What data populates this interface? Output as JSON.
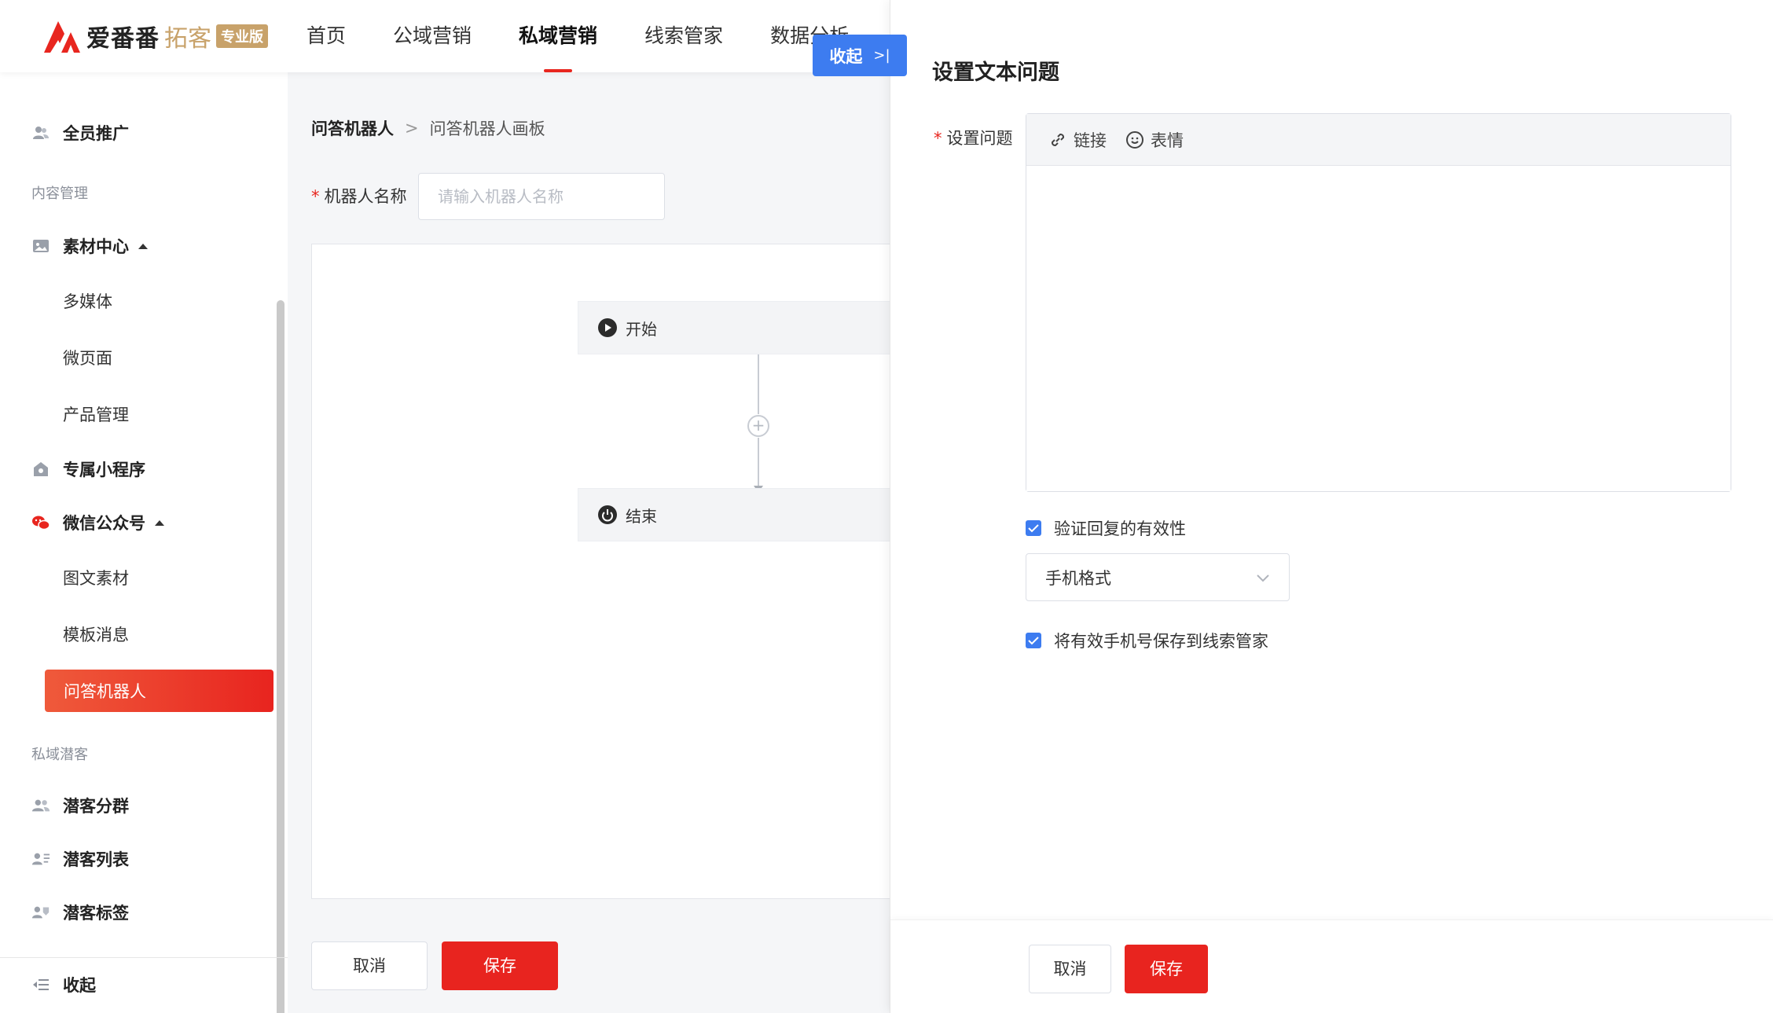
{
  "brand": {
    "name": "爱番番",
    "sub": "拓客",
    "badge": "专业版",
    "accent": "#e8261f"
  },
  "nav": {
    "items": [
      {
        "label": "首页"
      },
      {
        "label": "公域营销"
      },
      {
        "label": "私域营销",
        "active": true
      },
      {
        "label": "线索管家"
      },
      {
        "label": "数据分析"
      }
    ]
  },
  "sidebar": {
    "all_promo": "全员推广",
    "content_section": "内容管理",
    "material_center": "素材中心",
    "multimedia": "多媒体",
    "micro_page": "微页面",
    "product_mgmt": "产品管理",
    "mini_program": "专属小程序",
    "wechat_oa": "微信公众号",
    "graphic_material": "图文素材",
    "template_msg": "模板消息",
    "qa_robot": "问答机器人",
    "private_section": "私域潜客",
    "lead_groups": "潜客分群",
    "lead_list": "潜客列表",
    "lead_tags": "潜客标签",
    "collapse": "收起"
  },
  "main": {
    "breadcrumb": {
      "root": "问答机器人",
      "current": "问答机器人画板"
    },
    "robot_name_label": "机器人名称",
    "robot_name_placeholder": "请输入机器人名称",
    "robot_name_value": "",
    "start_node": "开始",
    "end_node": "结束",
    "cancel": "取消",
    "save": "保存"
  },
  "collapse_float": {
    "label": "收起",
    "chevron": ">|"
  },
  "panel": {
    "title": "设置文本问题",
    "question_label": "设置问题",
    "toolbar": {
      "link": "链接",
      "emoji": "表情"
    },
    "question_value": "",
    "validate_label": "验证回复的有效性",
    "validate_checked": true,
    "format_value": "手机格式",
    "save_phone_label": "将有效手机号保存到线索管家",
    "save_phone_checked": true,
    "cancel": "取消",
    "save": "保存"
  },
  "colors": {
    "primary": "#e8241f",
    "blue": "#3d7cf0"
  }
}
